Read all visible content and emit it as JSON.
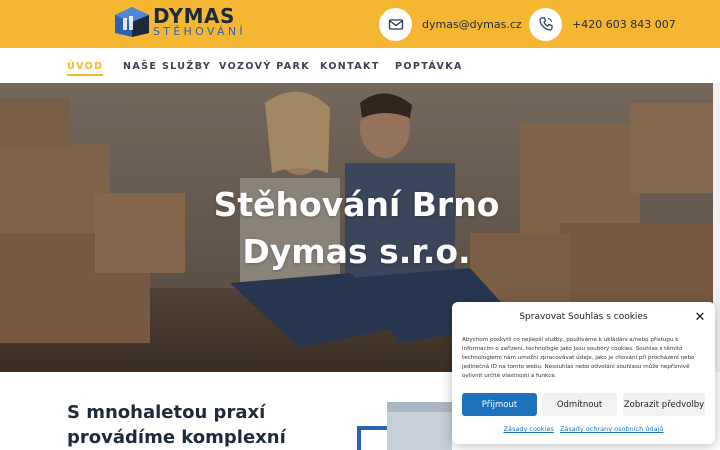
{
  "brand": {
    "name": "DYMAS",
    "tagline": "STĚHOVÁNÍ",
    "colors": {
      "accent": "#f5b731",
      "navy": "#1e2a3c",
      "blue": "#2a62b8"
    }
  },
  "topbar": {
    "email": {
      "icon": "envelope-icon",
      "text": "dymas@dymas.cz"
    },
    "phone": {
      "icon": "phone-icon",
      "text": "+420 603 843 007"
    }
  },
  "nav": {
    "items": [
      {
        "label": "ÚVOD",
        "active": true
      },
      {
        "label": "NAŠE SLUŽBY",
        "active": false
      },
      {
        "label": "VOZOVÝ PARK",
        "active": false
      },
      {
        "label": "KONTAKT",
        "active": false
      },
      {
        "label": "POPTÁVKA",
        "active": false
      }
    ]
  },
  "hero": {
    "title_line1": "Stěhování Brno",
    "title_line2": "Dymas s.r.o."
  },
  "intro": {
    "heading_line1": "S mnohaletou praxí",
    "heading_line2": "provádíme komplexní"
  },
  "cookie_dialog": {
    "title": "Spravovat Souhlas s cookies",
    "close_icon": "close-icon",
    "text": "Abychom poskytli co nejlepší služby, používáme k ukládání a/nebo přístupu k informacím o zařízení, technologie jako jsou soubory cookies. Souhlas s těmito technologiemi nám umožní zpracovávat údaje, jako je chování při procházení nebo jedinečná ID na tomto webu. Nesouhlas nebo odvolání souhlasu může nepříznivě ovlivnit určité vlastnosti a funkce.",
    "accept_label": "Přijmout",
    "deny_label": "Odmítnout",
    "prefs_label": "Zobrazit předvolby",
    "link_cookies": "Zásady cookies",
    "link_privacy": "Zásady ochrany osobních údajů"
  }
}
